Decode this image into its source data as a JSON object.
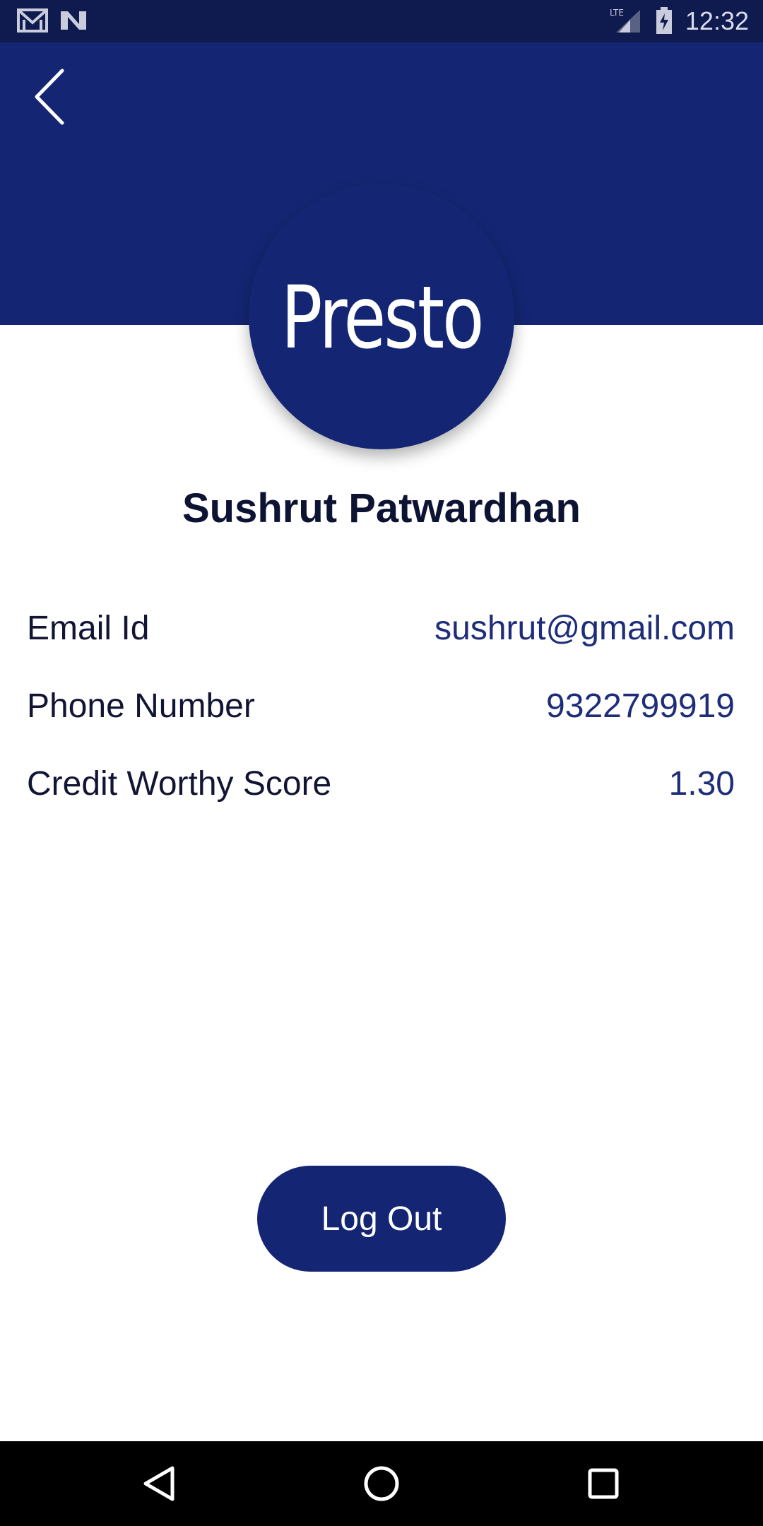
{
  "status_bar": {
    "time": "12:32",
    "icons": [
      "gmail-icon",
      "news-icon",
      "lte-signal-icon",
      "battery-charging-icon"
    ]
  },
  "header": {
    "back_icon": "chevron-left-icon",
    "logo_text": "Presto"
  },
  "profile": {
    "name": "Sushrut Patwardhan",
    "fields": [
      {
        "label": "Email Id",
        "value": "sushrut@gmail.com"
      },
      {
        "label": "Phone Number",
        "value": "9322799919"
      },
      {
        "label": "Credit Worthy Score",
        "value": "1.30"
      }
    ]
  },
  "actions": {
    "logout_label": "Log Out"
  },
  "nav_bar": {
    "icons": [
      "back-triangle-icon",
      "home-circle-icon",
      "recents-square-icon"
    ]
  },
  "colors": {
    "primary": "#142673",
    "status_bar": "#0f1a4f",
    "value_text": "#1e2d79",
    "label_text": "#111533"
  }
}
